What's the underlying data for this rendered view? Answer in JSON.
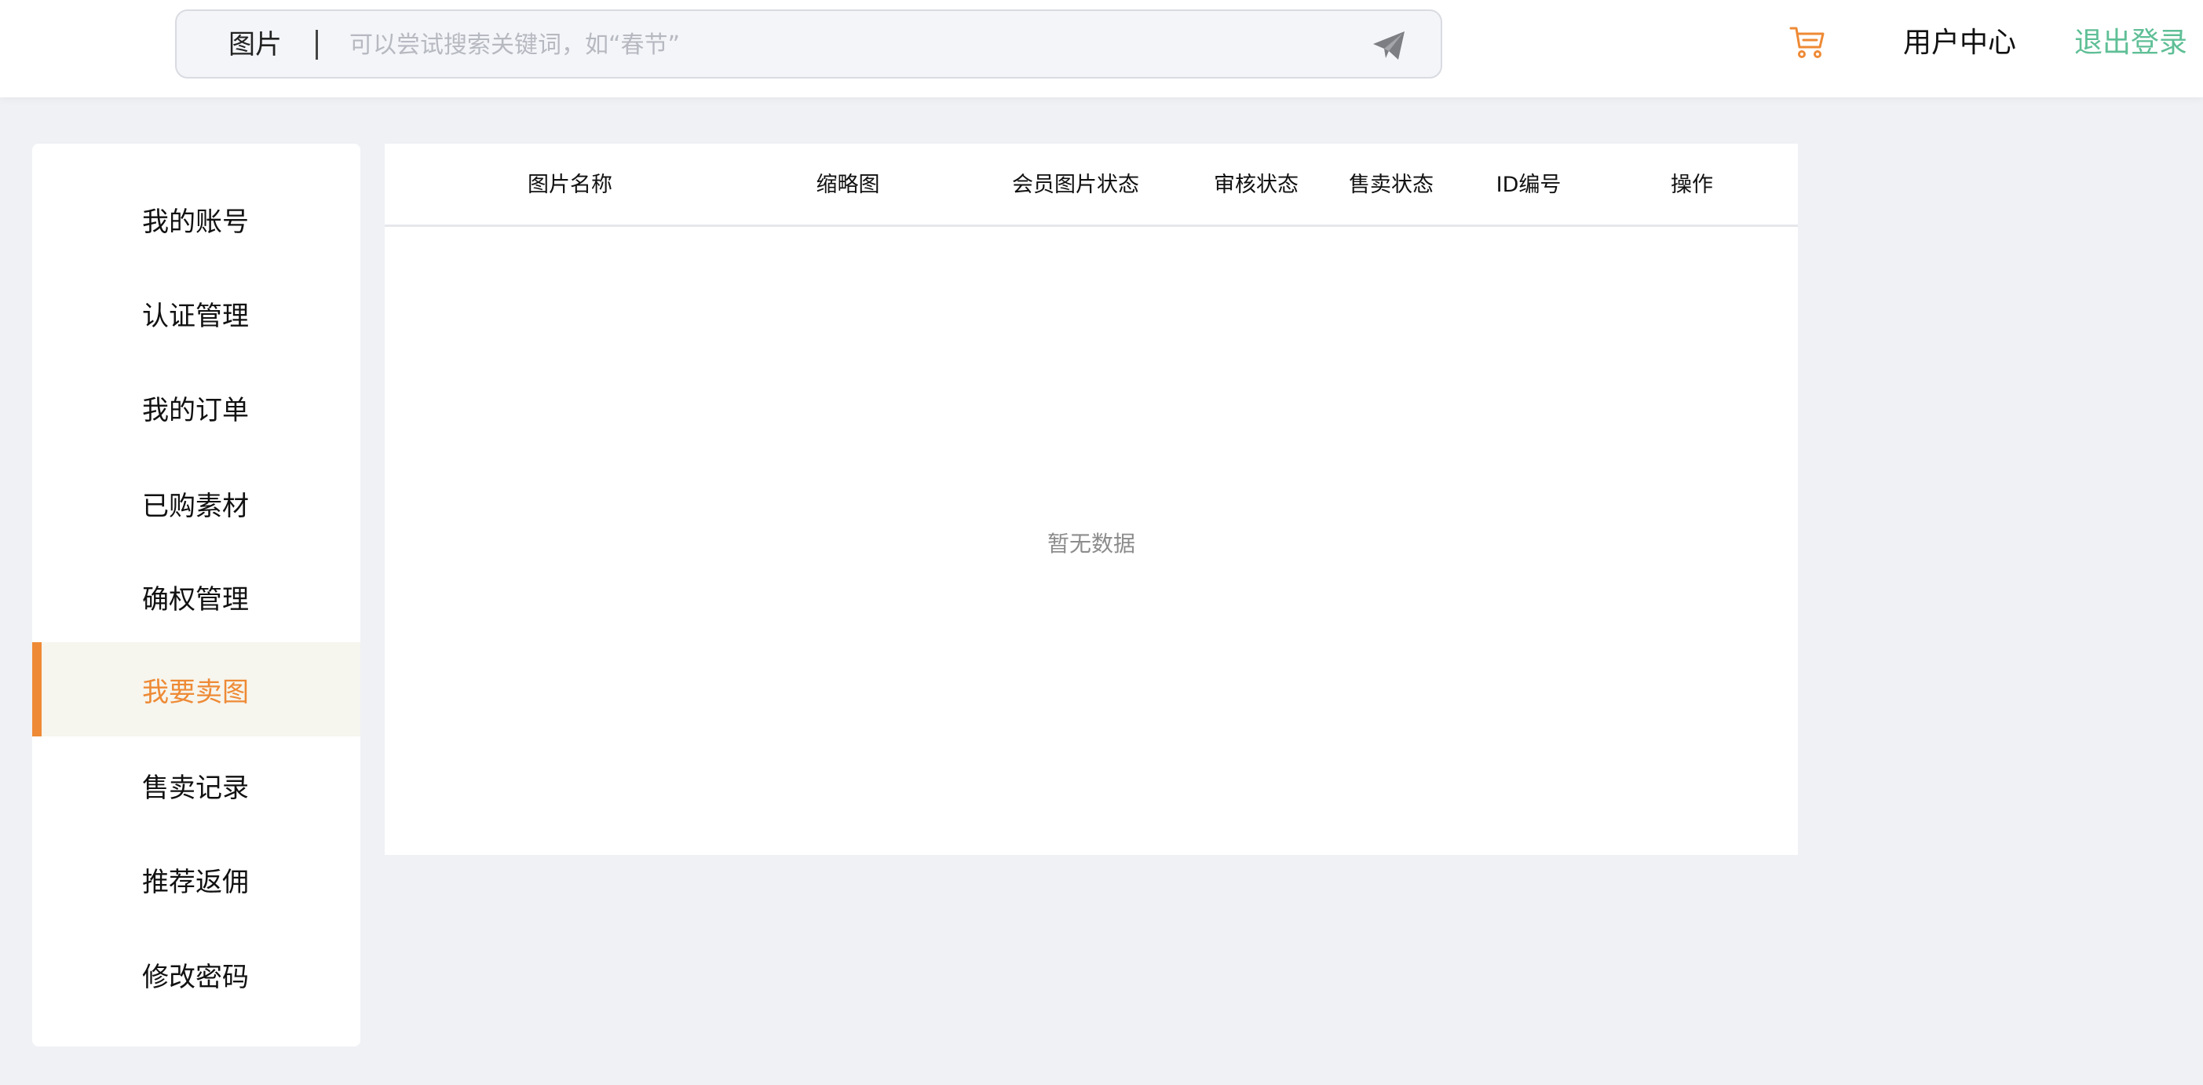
{
  "header": {
    "search": {
      "category": "图片",
      "placeholder": "可以尝试搜索关键词，如“春节”",
      "value": ""
    },
    "user_center_label": "用户中心",
    "logout_label": "退出登录",
    "colors": {
      "cart": "#ee8a35",
      "logout": "#5fbf96",
      "send_icon": "#7d7e84"
    }
  },
  "sidebar": {
    "items": [
      {
        "label": "我的账号",
        "active": false
      },
      {
        "label": "认证管理",
        "active": false
      },
      {
        "label": "我的订单",
        "active": false
      },
      {
        "label": "已购素材",
        "active": false
      },
      {
        "label": "确权管理",
        "active": false
      },
      {
        "label": "我要卖图",
        "active": true
      },
      {
        "label": "售卖记录",
        "active": false
      },
      {
        "label": "推荐返佣",
        "active": false
      },
      {
        "label": "修改密码",
        "active": false
      }
    ],
    "active_color": "#ee8a35"
  },
  "table": {
    "columns": [
      "图片名称",
      "缩略图",
      "会员图片状态",
      "审核状态",
      "售卖状态",
      "ID编号",
      "操作"
    ],
    "rows": [],
    "empty_text": "暂无数据"
  }
}
